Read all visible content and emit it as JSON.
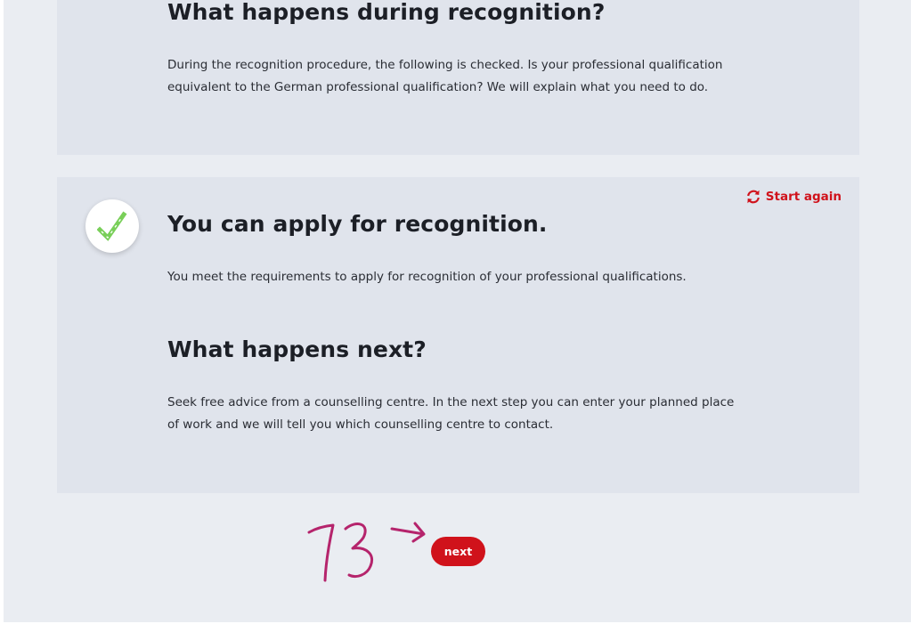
{
  "colors": {
    "accent_red": "#d0121b",
    "page_background": "#eaedf2",
    "card_background": "#e0e4ec",
    "check_green": "#79cf59",
    "annotation_magenta": "#b5246c"
  },
  "recognition_section": {
    "heading": "What happens during recognition?",
    "body": "During the recognition procedure, the following is checked. Is your professional qualification equivalent to the German professional qualification? We will explain what you need to do."
  },
  "result_card": {
    "status_icon": "checkmark-icon",
    "start_again_icon": "refresh-icon",
    "start_again_label": "Start again",
    "title": "You can apply for recognition.",
    "body": "You meet the requirements to apply for recognition of your professional qualifications.",
    "next_heading": "What happens next?",
    "next_body": "Seek free advice from a counselling centre. In the next step you can enter your planned place of work and we will tell you which counselling centre to contact."
  },
  "navigation": {
    "next_label": "next"
  }
}
